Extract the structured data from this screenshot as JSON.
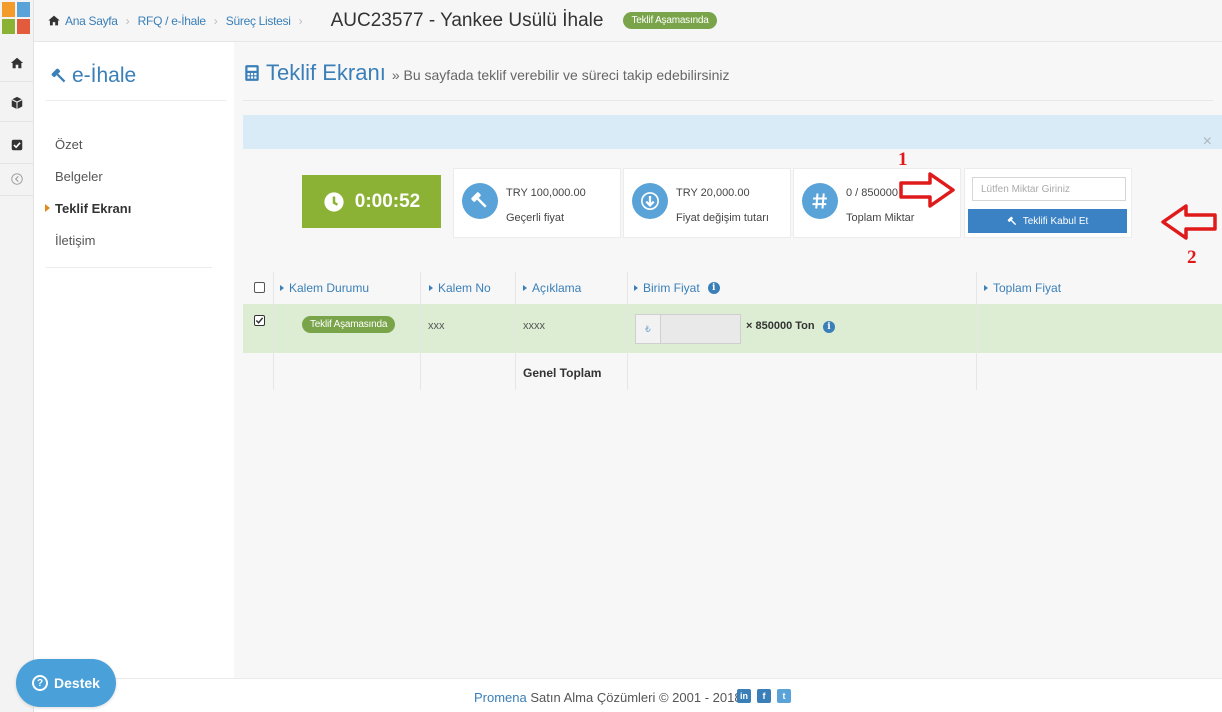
{
  "breadcrumb": {
    "home": "Ana Sayfa",
    "rfq": "RFQ / e-İhale",
    "process": "Süreç Listesi",
    "sep": "›",
    "title": "AUC23577 - Yankee Usülü İhale",
    "status": "Teklif Aşamasında"
  },
  "sidebar": {
    "title": "e-İhale",
    "items": [
      {
        "label": "Özet"
      },
      {
        "label": "Belgeler"
      },
      {
        "label": "Teklif Ekranı",
        "active": true
      },
      {
        "label": "İletişim"
      }
    ]
  },
  "main": {
    "title": "Teklif Ekranı",
    "subtitle": "» Bu sayfada teklif verebilir ve süreci takip edebilirsiniz",
    "alert_close": "×"
  },
  "stats": {
    "timer": "0:00:52",
    "current_price": {
      "value": "TRY 100,000.00",
      "label": "Geçerli fiyat"
    },
    "price_change": {
      "value": "TRY 20,000.00",
      "label": "Fiyat değişim tutarı"
    },
    "total_quantity": {
      "value": "0 / 850000",
      "label": "Toplam Miktar"
    }
  },
  "bid": {
    "quantity_placeholder": "Lütfen Miktar Giriniz",
    "accept_label": "Teklifi Kabul Et"
  },
  "annotations": {
    "first": "1",
    "second": "2"
  },
  "table": {
    "headers": [
      "Kalem Durumu",
      "Kalem No",
      "Açıklama",
      "Birim Fiyat",
      "Toplam Fiyat"
    ],
    "rows": [
      {
        "status": "Teklif Aşamasında",
        "item_no": "xxx",
        "description": "xxxx",
        "quantity": "× 850000 Ton",
        "total": ""
      }
    ],
    "grand_total_label": "Genel Toplam"
  },
  "footer": {
    "brand": "Promena",
    "text": "Satın Alma Çözümleri © 2001 - 2018",
    "social": [
      "in",
      "f",
      "t"
    ]
  },
  "support_label": "Destek",
  "colors": {
    "accent": "#3a7fb8",
    "timer": "#8bb234",
    "status_pill": "#7aa44a",
    "annotation": "#e01a1a",
    "row_highlight": "#dcedd3"
  }
}
